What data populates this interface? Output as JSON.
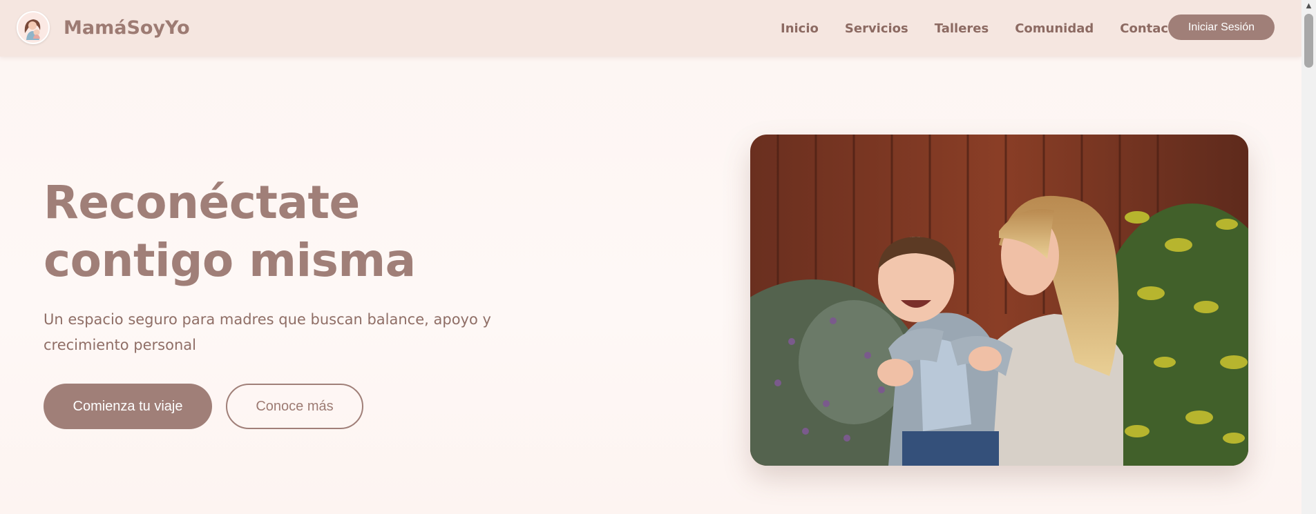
{
  "brand": {
    "name": "MamáSoyYo",
    "logo_icon": "mother-child-logo-icon"
  },
  "nav": {
    "links": [
      "Inicio",
      "Servicios",
      "Talleres",
      "Comunidad",
      "Contacto"
    ],
    "login_label": "Iniciar Sesión"
  },
  "hero": {
    "title": "Reconéctate contigo misma",
    "subtitle": "Un espacio seguro para madres que buscan balance, apoyo y crecimiento personal",
    "primary_cta": "Comienza tu viaje",
    "secondary_cta": "Conoce más",
    "image_icon": "mother-and-child-photo"
  },
  "colors": {
    "accent": "#a07f78",
    "navbar_bg": "#f5e6e0",
    "page_bg": "#fdf5f2",
    "text": "#8f6e66"
  }
}
